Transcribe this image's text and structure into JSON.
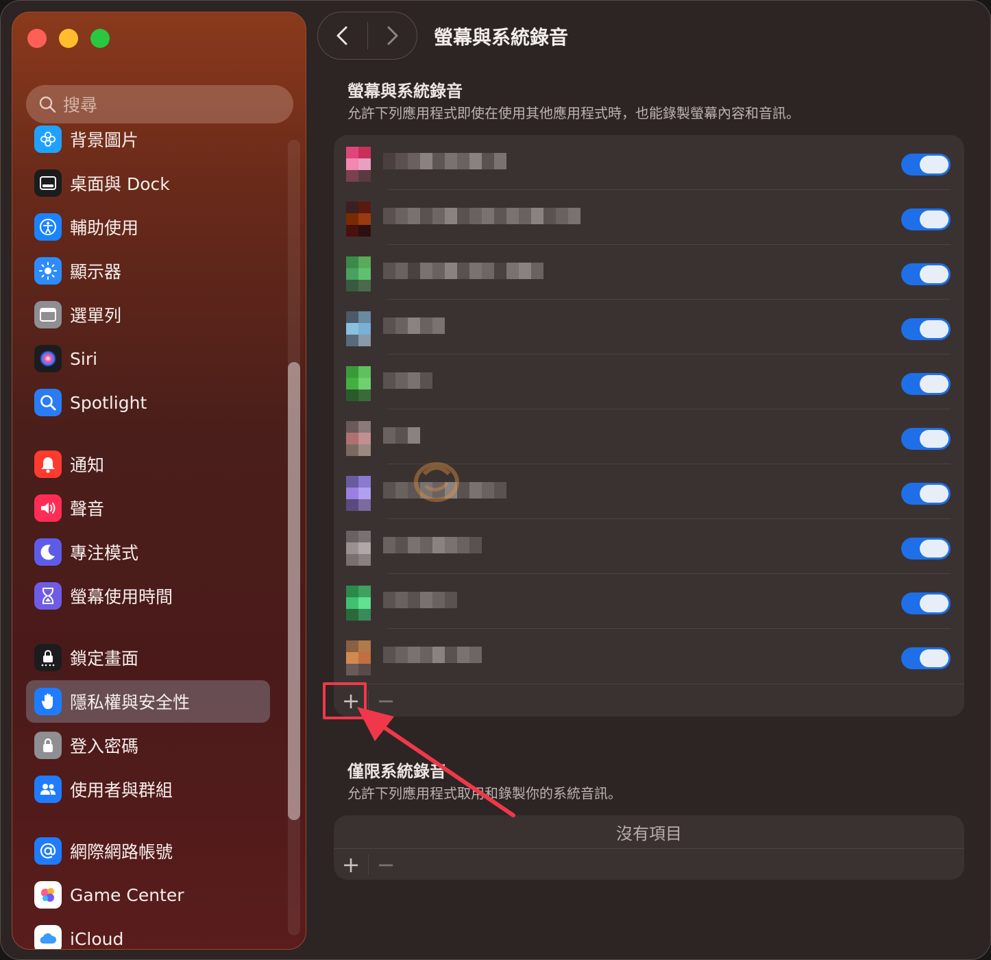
{
  "sidebar": {
    "search_placeholder": "搜尋",
    "items": [
      {
        "label": "背景圖片",
        "icon": "wallpaper-icon",
        "color": "#1fa2ff"
      },
      {
        "label": "桌面與 Dock",
        "icon": "dock-icon",
        "color": "#1c1c1e"
      },
      {
        "label": "輔助使用",
        "icon": "accessibility-icon",
        "color": "#1a84ff"
      },
      {
        "label": "顯示器",
        "icon": "display-icon",
        "color": "#2d8cff"
      },
      {
        "label": "選單列",
        "icon": "menubar-icon",
        "color": "#8e8e93"
      },
      {
        "label": "Siri",
        "icon": "siri-icon",
        "color": "#1c1c1e"
      },
      {
        "label": "Spotlight",
        "icon": "spotlight-icon",
        "color": "#2a7cf5"
      },
      {
        "label": "通知",
        "icon": "bell-icon",
        "color": "#ff3b30"
      },
      {
        "label": "聲音",
        "icon": "speaker-icon",
        "color": "#ff2d55"
      },
      {
        "label": "專注模式",
        "icon": "moon-icon",
        "color": "#5e5ce6"
      },
      {
        "label": "螢幕使用時間",
        "icon": "hourglass-icon",
        "color": "#6e5ce6"
      },
      {
        "label": "鎖定畫面",
        "icon": "lock-screen-icon",
        "color": "#1c1c1e"
      },
      {
        "label": "隱私權與安全性",
        "icon": "hand-icon",
        "color": "#1f7cff"
      },
      {
        "label": "登入密碼",
        "icon": "lock-icon",
        "color": "#8e8e93"
      },
      {
        "label": "使用者與群組",
        "icon": "users-icon",
        "color": "#1f7cff"
      },
      {
        "label": "網際網路帳號",
        "icon": "at-icon",
        "color": "#1f7cff"
      },
      {
        "label": "Game Center",
        "icon": "game-center-icon",
        "color": "#ffffff"
      },
      {
        "label": "iCloud",
        "icon": "icloud-icon",
        "color": "#ffffff"
      }
    ],
    "selected": "隱私權與安全性"
  },
  "toolbar": {
    "back_icon": "chevron-left-icon",
    "forward_icon": "chevron-right-icon",
    "title": "螢幕與系統錄音"
  },
  "screen_recording": {
    "title": "螢幕與系統錄音",
    "description": "允許下列應用程式即使在使用其他應用程式時，也能錄製螢幕內容和音訊。",
    "apps": [
      {
        "enabled": true,
        "icon_colors": [
          "#e0467a",
          "#c8305a",
          "#f088b0",
          "#e8a0c0",
          "#7a4050",
          "#5a3a40"
        ],
        "name_colors": [
          "#4a4040",
          "#5a5050",
          "#6a6060",
          "#8a8280",
          "#5e5654",
          "#7a7270",
          "#6a6260",
          "#8a8280",
          "#5a5250",
          "#7a7270"
        ]
      },
      {
        "enabled": true,
        "icon_colors": [
          "#3a2020",
          "#5a1a10",
          "#7a2a00",
          "#9a3a10",
          "#4a1010",
          "#2a1010"
        ],
        "name_colors": [
          "#5a5050",
          "#6a6260",
          "#7a7270",
          "#5a5250",
          "#6e6664",
          "#8a8280",
          "#5a5250",
          "#6a6260",
          "#7a7270",
          "#5e5654",
          "#7a7270",
          "#6a6260",
          "#8a8280",
          "#5a5250",
          "#6a6260",
          "#7a7270"
        ]
      },
      {
        "enabled": true,
        "icon_colors": [
          "#3a8a4a",
          "#5aaa5a",
          "#4aa060",
          "#60c070",
          "#3a5a40",
          "#4a6a4a"
        ],
        "name_colors": [
          "#5a5250",
          "#6a6260",
          "#4a4240",
          "#7a7270",
          "#6a6260",
          "#8a8280",
          "#5a5250",
          "#7a7270",
          "#6e6664",
          "#4a4240",
          "#7a7270",
          "#8a8280",
          "#6a6260"
        ]
      },
      {
        "enabled": true,
        "icon_colors": [
          "#4a5a6a",
          "#6a8aa0",
          "#8ac0e0",
          "#7ab0d8",
          "#5a6a7a",
          "#8a9aa8"
        ],
        "name_colors": [
          "#5a5250",
          "#6a6260",
          "#8a8280",
          "#6a6260",
          "#7a7270"
        ]
      },
      {
        "enabled": true,
        "icon_colors": [
          "#3a9a3a",
          "#60c060",
          "#40b040",
          "#70d070",
          "#2a5a2a",
          "#3a6a3a"
        ],
        "name_colors": [
          "#5a5250",
          "#6a6260",
          "#7a7270",
          "#5a5250"
        ]
      },
      {
        "enabled": true,
        "icon_colors": [
          "#6a5a5a",
          "#8a7a7a",
          "#b07070",
          "#c09090",
          "#7a6a60",
          "#9a8a80"
        ],
        "name_colors": [
          "#6a6260",
          "#5a5250",
          "#8a8280"
        ]
      },
      {
        "enabled": true,
        "icon_colors": [
          "#6a5aa0",
          "#8a7ad0",
          "#9a80e0",
          "#b0a0f0",
          "#5a4a80",
          "#7a6aa0"
        ],
        "name_colors": [
          "#5a5250",
          "#6a6260",
          "#5e5654",
          "#7a7270",
          "#6a6260",
          "#8a8280",
          "#5a5250",
          "#7a7270",
          "#6a6260",
          "#5a5250"
        ]
      },
      {
        "enabled": true,
        "icon_colors": [
          "#6a6262",
          "#7a7272",
          "#9a9090",
          "#b0a8a8",
          "#7a7070",
          "#8a8080"
        ],
        "name_colors": [
          "#6a6260",
          "#5a5250",
          "#7a7270",
          "#6a6260",
          "#8a8280",
          "#7a7270",
          "#6a6260",
          "#5a5250"
        ]
      },
      {
        "enabled": true,
        "icon_colors": [
          "#2a8a4a",
          "#40a060",
          "#40c070",
          "#60e090",
          "#2a6a3a",
          "#3a8a5a"
        ],
        "name_colors": [
          "#5a5250",
          "#6a6260",
          "#5a5250",
          "#7a7270",
          "#6a6260",
          "#5a5250"
        ]
      },
      {
        "enabled": true,
        "icon_colors": [
          "#8a6040",
          "#b07a4a",
          "#d08a50",
          "#c07040",
          "#6a5a5a",
          "#5a4a4a"
        ],
        "name_colors": [
          "#5a5250",
          "#6a6260",
          "#7a7270",
          "#6a6260",
          "#8a8280",
          "#5a5250",
          "#7a7270",
          "#6e6664"
        ]
      }
    ]
  },
  "system_audio": {
    "title": "僅限系統錄音",
    "description": "允許下列應用程式取用和錄製你的系統音訊。",
    "empty_label": "沒有項目"
  },
  "controls": {
    "add_label": "+",
    "remove_label": "−"
  },
  "annotation": {
    "highlight_color": "#f0384a"
  }
}
